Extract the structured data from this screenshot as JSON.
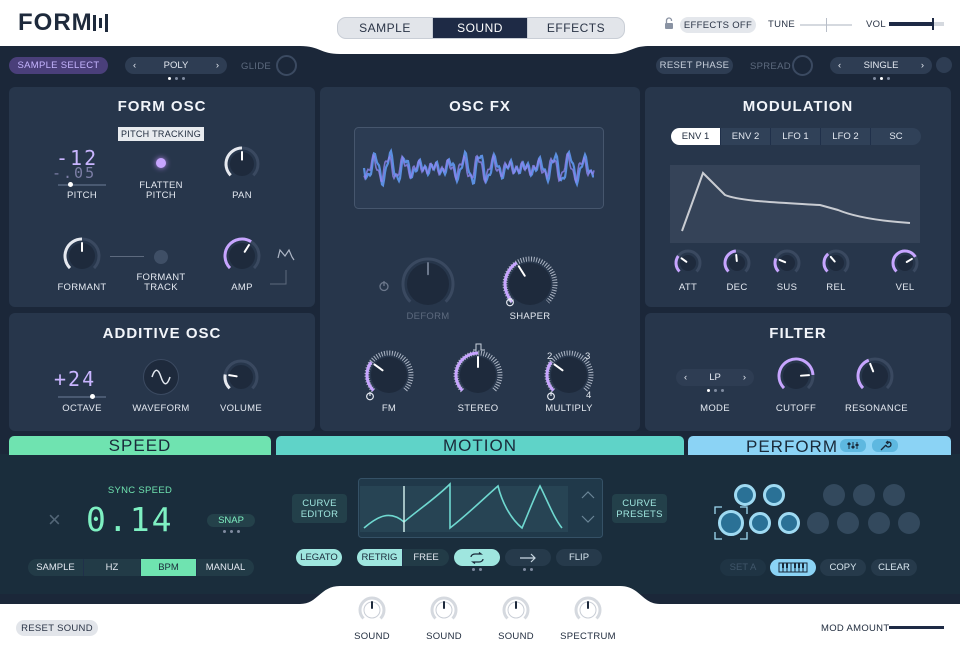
{
  "header": {
    "logo": "FORM",
    "tabs": [
      {
        "label": "SAMPLE"
      },
      {
        "label": "SOUND",
        "active": true
      },
      {
        "label": "EFFECTS"
      }
    ],
    "effects_off": "EFFECTS OFF",
    "tune_label": "TUNE",
    "tune_level": 0.5,
    "vol_label": "VOL",
    "vol_level": 0.78
  },
  "toolbar": {
    "sample_select": "SAMPLE SELECT",
    "voice_mode": "POLY",
    "glide": "GLIDE",
    "reset_phase": "RESET PHASE",
    "spread": "SPREAD",
    "unison_mode": "SINGLE"
  },
  "form_osc": {
    "title": "FORM OSC",
    "pitch_tracking": "PITCH TRACKING",
    "pitch_coarse": "-12",
    "pitch_fine": "-.05",
    "pitch_label": "PITCH",
    "flatten_label_1": "FLATTEN",
    "flatten_label_2": "PITCH",
    "pan_label": "PAN",
    "formant_label": "FORMANT",
    "formant_track_1": "FORMANT",
    "formant_track_2": "TRACK",
    "amp_label": "AMP"
  },
  "osc_fx": {
    "title": "OSC FX",
    "deform_label": "DEFORM",
    "shaper_label": "SHAPER",
    "fm_label": "FM",
    "stereo_label": "STEREO",
    "multiply_label": "MULTIPLY",
    "multiply_ticks": [
      "2",
      "3",
      "4"
    ]
  },
  "modulation": {
    "title": "MODULATION",
    "tabs": [
      {
        "label": "ENV 1",
        "active": true
      },
      {
        "label": "ENV 2"
      },
      {
        "label": "LFO 1"
      },
      {
        "label": "LFO 2"
      },
      {
        "label": "SC"
      }
    ],
    "knobs": [
      "ATT",
      "DEC",
      "SUS",
      "REL",
      "VEL"
    ]
  },
  "additive_osc": {
    "title": "ADDITIVE OSC",
    "octave_value": "+24",
    "octave_label": "OCTAVE",
    "waveform_label": "WAVEFORM",
    "volume_label": "VOLUME"
  },
  "filter": {
    "title": "FILTER",
    "mode_value": "LP",
    "mode_label": "MODE",
    "cutoff_label": "CUTOFF",
    "resonance_label": "RESONANCE"
  },
  "speed": {
    "title": "SPEED",
    "sync_speed": "SYNC SPEED",
    "multiplier": "×",
    "value": "0.14",
    "snap": "SNAP",
    "modes": [
      {
        "label": "SAMPLE"
      },
      {
        "label": "HZ"
      },
      {
        "label": "BPM",
        "active": true
      },
      {
        "label": "MANUAL"
      }
    ]
  },
  "motion": {
    "title": "MOTION",
    "curve_editor_1": "CURVE",
    "curve_editor_2": "EDITOR",
    "curve_presets_1": "CURVE",
    "curve_presets_2": "PRESETS",
    "legato": "LEGATO",
    "retrig": "RETRIG",
    "free": "FREE",
    "flip": "FLIP"
  },
  "perform": {
    "title": "PERFORM",
    "set_a": "SET A",
    "copy": "COPY",
    "clear": "CLEAR"
  },
  "footer": {
    "reset_sound": "RESET SOUND",
    "knobs": [
      "SOUND",
      "SOUND",
      "SOUND",
      "SPECTRUM"
    ],
    "mod_amount": "MOD AMOUNT"
  },
  "colors": {
    "accent_purple": "#b98cf0",
    "speed_green": "#6fe3b0",
    "motion_teal": "#5fd3c8",
    "perform_blue": "#8bd3f5"
  }
}
